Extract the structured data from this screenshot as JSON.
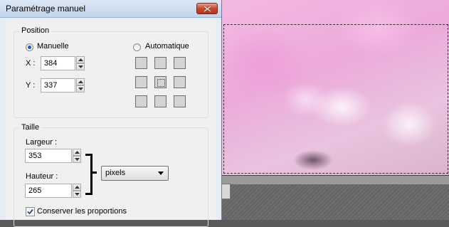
{
  "dialog": {
    "title": "Paramétrage manuel",
    "position": {
      "group_label": "Position",
      "manual_label": "Manuelle",
      "manual_selected": true,
      "auto_label": "Automatique",
      "auto_selected": false,
      "x_label": "X :",
      "x_value": "384",
      "y_label": "Y :",
      "y_value": "337",
      "anchor_selected": "center"
    },
    "size": {
      "group_label": "Taille",
      "width_label": "Largeur :",
      "width_value": "353",
      "height_label": "Hauteur :",
      "height_value": "265",
      "unit": "pixels",
      "keep_ratio_label": "Conserver les proportions",
      "keep_ratio_checked": true
    }
  },
  "colors": {
    "title_bar": "#c2d4ea",
    "close_button": "#c6452c",
    "dialog_bg": "#f0f0f0",
    "radio_dot": "#1e5cc7"
  },
  "icons": [
    "close-icon",
    "spin-up-icon",
    "spin-down-icon",
    "dropdown-arrow-icon",
    "checkmark-icon"
  ]
}
